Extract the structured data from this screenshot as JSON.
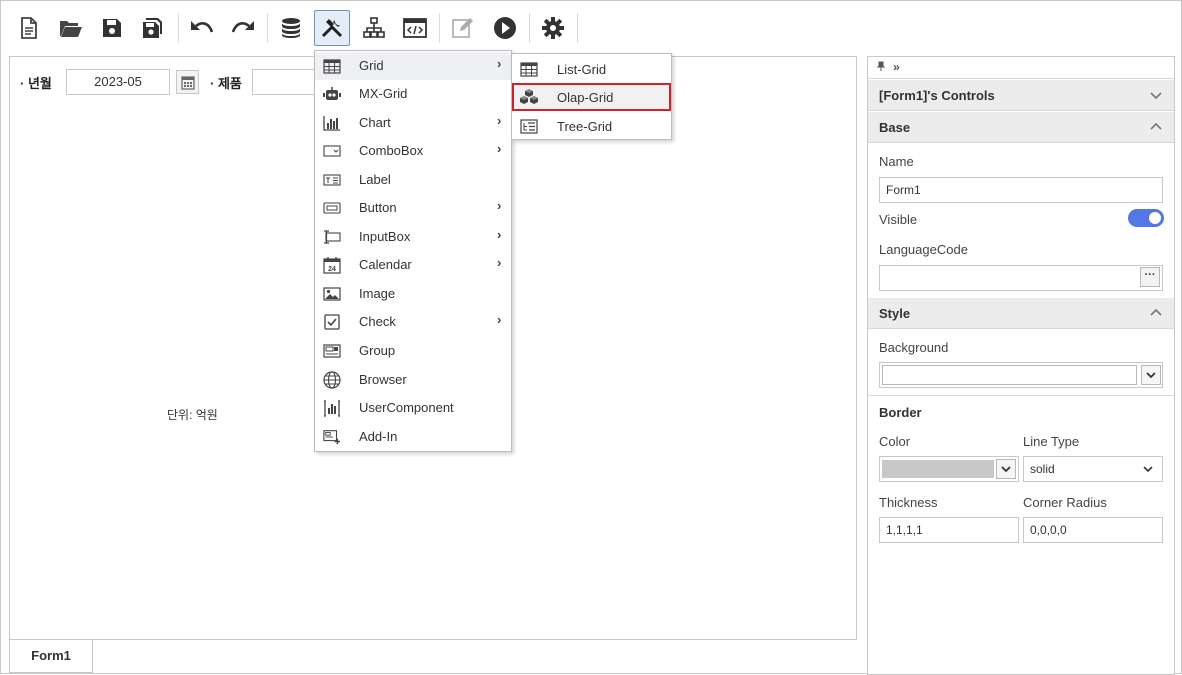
{
  "toolbar": {
    "buttons": [
      {
        "name": "new-document-icon"
      },
      {
        "name": "open-folder-icon"
      },
      {
        "name": "save-icon"
      },
      {
        "name": "save-all-icon"
      },
      {
        "name": "undo-icon"
      },
      {
        "name": "redo-icon"
      },
      {
        "name": "database-icon"
      },
      {
        "name": "tools-icon",
        "active": true
      },
      {
        "name": "hierarchy-icon"
      },
      {
        "name": "code-window-icon"
      },
      {
        "name": "edit-icon",
        "disabled": true
      },
      {
        "name": "play-icon"
      },
      {
        "name": "gear-icon"
      }
    ]
  },
  "designer": {
    "year_month_label": "· 년월",
    "year_month_value": "2023-05",
    "product_label": "· 제품",
    "unit_label": "단위: 억원",
    "tab_label": "Form1"
  },
  "context_menu": {
    "items": [
      {
        "label": "Grid",
        "icon": "grid-icon",
        "has_submenu": true,
        "highlighted": true
      },
      {
        "label": "MX-Grid",
        "icon": "robot-icon",
        "has_submenu": false
      },
      {
        "label": "Chart",
        "icon": "chart-icon",
        "has_submenu": true
      },
      {
        "label": "ComboBox",
        "icon": "combobox-icon",
        "has_submenu": true
      },
      {
        "label": "Label",
        "icon": "label-icon",
        "has_submenu": false
      },
      {
        "label": "Button",
        "icon": "button-icon",
        "has_submenu": true
      },
      {
        "label": "InputBox",
        "icon": "inputbox-icon",
        "has_submenu": true
      },
      {
        "label": "Calendar",
        "icon": "calendar-icon",
        "has_submenu": true
      },
      {
        "label": "Image",
        "icon": "image-icon",
        "has_submenu": false
      },
      {
        "label": "Check",
        "icon": "check-icon",
        "has_submenu": true
      },
      {
        "label": "Group",
        "icon": "group-icon",
        "has_submenu": false
      },
      {
        "label": "Browser",
        "icon": "globe-icon",
        "has_submenu": false
      },
      {
        "label": "UserComponent",
        "icon": "user-component-icon",
        "has_submenu": false
      },
      {
        "label": "Add-In",
        "icon": "add-in-icon",
        "has_submenu": false
      }
    ],
    "arrow": "›"
  },
  "submenu": {
    "items": [
      {
        "label": "List-Grid",
        "icon": "list-grid-icon"
      },
      {
        "label": "Olap-Grid",
        "icon": "olap-grid-icon",
        "selected": true
      },
      {
        "label": "Tree-Grid",
        "icon": "tree-grid-icon"
      }
    ]
  },
  "properties": {
    "pin_glyphs": "🖈 »",
    "controls_title": "[Form1]'s Controls",
    "base_section": "Base",
    "name_label": "Name",
    "name_value": "Form1",
    "visible_label": "Visible",
    "visible_on": true,
    "language_code_label": "LanguageCode",
    "language_code_value": "",
    "dots_label": "···",
    "style_section": "Style",
    "background_label": "Background",
    "border_label": "Border",
    "color_label": "Color",
    "color_value_hex": "#c8c8c8",
    "line_type_label": "Line Type",
    "line_type_value": "solid",
    "thickness_label": "Thickness",
    "thickness_value": "1,1,1,1",
    "corner_radius_label": "Corner Radius",
    "corner_radius_value": "0,0,0,0"
  },
  "colors": {
    "accent": "#5577e6",
    "selection_border": "#d0222c",
    "section_bg": "#ececec"
  }
}
